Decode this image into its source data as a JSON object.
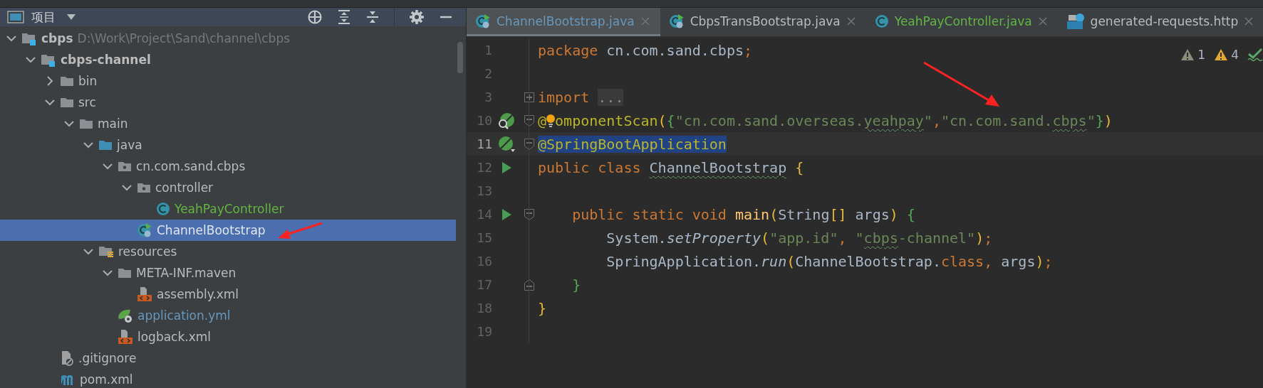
{
  "project_panel": {
    "title": "项目",
    "tree": [
      {
        "name": "cbps",
        "path": "D:\\Work\\Project\\Sand\\channel\\cbps",
        "kind": "module",
        "bold": true,
        "expanded": true,
        "selected": false,
        "children": [
          {
            "name": "cbps-channel",
            "kind": "module",
            "bold": true,
            "expanded": true,
            "selected": false,
            "children": [
              {
                "name": "bin",
                "kind": "folder",
                "expanded": false,
                "selected": false
              },
              {
                "name": "src",
                "kind": "folder",
                "expanded": true,
                "selected": false,
                "children": [
                  {
                    "name": "main",
                    "kind": "folder",
                    "expanded": true,
                    "selected": false,
                    "children": [
                      {
                        "name": "java",
                        "kind": "source-folder",
                        "expanded": true,
                        "selected": false,
                        "children": [
                          {
                            "name": "cn.com.sand.cbps",
                            "kind": "package",
                            "expanded": true,
                            "selected": false,
                            "children": [
                              {
                                "name": "controller",
                                "kind": "package",
                                "expanded": true,
                                "selected": false,
                                "children": [
                                  {
                                    "name": "YeahPayController",
                                    "kind": "class",
                                    "color": "#62b543",
                                    "selected": false
                                  }
                                ]
                              },
                              {
                                "name": "ChannelBootstrap",
                                "kind": "spring-class",
                                "selected": true
                              }
                            ]
                          }
                        ]
                      },
                      {
                        "name": "resources",
                        "kind": "resources-folder",
                        "expanded": true,
                        "selected": false,
                        "children": [
                          {
                            "name": "META-INF.maven",
                            "kind": "folder",
                            "expanded": true,
                            "selected": false,
                            "children": [
                              {
                                "name": "assembly.xml",
                                "kind": "xml",
                                "selected": false
                              }
                            ]
                          },
                          {
                            "name": "application.yml",
                            "kind": "yml",
                            "color": "#6897bb",
                            "selected": false
                          },
                          {
                            "name": "logback.xml",
                            "kind": "xml",
                            "selected": false
                          }
                        ]
                      }
                    ]
                  }
                ]
              },
              {
                "name": ".gitignore",
                "kind": "ignore-file",
                "selected": false
              },
              {
                "name": "pom.xml",
                "kind": "maven",
                "selected": false
              }
            ]
          }
        ]
      }
    ]
  },
  "editor": {
    "tabs": [
      {
        "label": "ChannelBootstrap.java",
        "kind": "spring-class",
        "color": "#6897bb",
        "selected": true
      },
      {
        "label": "CbpsTransBootstrap.java",
        "kind": "spring-class",
        "selected": false
      },
      {
        "label": "YeahPayController.java",
        "kind": "class",
        "color": "#62b543",
        "selected": false
      },
      {
        "label": "generated-requests.http",
        "kind": "api",
        "selected": false
      }
    ],
    "inspections": [
      {
        "kind": "weak-warning",
        "count": "1"
      },
      {
        "kind": "warning",
        "count": "4"
      },
      {
        "kind": "typo"
      }
    ],
    "lines": [
      {
        "number": "1",
        "tokens": [
          {
            "text": "package ",
            "kind": "keyword"
          },
          {
            "text": "cn.com.sand.cbps",
            "kind": "plain"
          },
          {
            "text": ";",
            "kind": "keyword"
          }
        ]
      },
      {
        "number": "2"
      },
      {
        "number": "3",
        "fold": {
          "kind": "expand"
        },
        "tokens": [
          {
            "text": "import ",
            "kind": "keyword"
          },
          {
            "text": "...",
            "kind": "folded"
          }
        ]
      },
      {
        "number": "10",
        "gutter": {
          "kind": "bean-search"
        },
        "fold": {
          "kind": "start"
        },
        "tokens": [
          {
            "text": "@",
            "kind": "annotation"
          },
          {
            "kind": "bulb"
          },
          {
            "text": "omponentScan",
            "kind": "annotation"
          },
          {
            "text": "(",
            "kind": "bracket-1"
          },
          {
            "text": "{",
            "kind": "bracket-2"
          },
          {
            "text": "\"cn.com.sand.overseas.",
            "kind": "string"
          },
          {
            "text": "yeahpay",
            "kind": "string",
            "typo": true
          },
          {
            "text": "\"",
            "kind": "string"
          },
          {
            "text": ",",
            "kind": "keyword"
          },
          {
            "text": "\"cn.com.sand.",
            "kind": "string"
          },
          {
            "text": "cbps",
            "kind": "string",
            "typo": true
          },
          {
            "text": "\"",
            "kind": "string"
          },
          {
            "text": "}",
            "kind": "bracket-2"
          },
          {
            "text": ")",
            "kind": "bracket-1"
          }
        ]
      },
      {
        "number": "11",
        "current": true,
        "gutter": {
          "kind": "bean"
        },
        "fold": {
          "kind": "start"
        },
        "tokens": [
          {
            "text": "@SpringBootApplication",
            "kind": "annotation",
            "selected": true
          }
        ]
      },
      {
        "number": "12",
        "gutter": {
          "kind": "run"
        },
        "tokens": [
          {
            "text": "public class ",
            "kind": "keyword"
          },
          {
            "text": "ChannelBootstrap",
            "kind": "plain",
            "typo": true
          },
          {
            "text": " {",
            "kind": "bracket-1"
          }
        ]
      },
      {
        "number": "13"
      },
      {
        "number": "14",
        "gutter": {
          "kind": "run"
        },
        "fold": {
          "kind": "start"
        },
        "tokens": [
          {
            "text": "    public static void ",
            "kind": "keyword"
          },
          {
            "text": "main",
            "kind": "method"
          },
          {
            "text": "(",
            "kind": "bracket-1"
          },
          {
            "text": "String",
            "kind": "plain"
          },
          {
            "text": "[]",
            "kind": "bracket-1"
          },
          {
            "text": " args",
            "kind": "plain"
          },
          {
            "text": ")",
            "kind": "bracket-1"
          },
          {
            "text": " {",
            "kind": "bracket-2"
          }
        ]
      },
      {
        "number": "15",
        "tokens": [
          {
            "text": "        System.",
            "kind": "plain"
          },
          {
            "text": "setProperty",
            "kind": "static-call"
          },
          {
            "text": "(",
            "kind": "bracket-1"
          },
          {
            "text": "\"app.id\"",
            "kind": "string"
          },
          {
            "text": ", ",
            "kind": "keyword"
          },
          {
            "text": "\"",
            "kind": "string"
          },
          {
            "text": "cbps",
            "kind": "string",
            "typo": true
          },
          {
            "text": "-channel\"",
            "kind": "string"
          },
          {
            "text": ")",
            "kind": "bracket-1"
          },
          {
            "text": ";",
            "kind": "keyword"
          }
        ]
      },
      {
        "number": "16",
        "tokens": [
          {
            "text": "        SpringApplication.",
            "kind": "plain"
          },
          {
            "text": "run",
            "kind": "static-call"
          },
          {
            "text": "(",
            "kind": "bracket-1"
          },
          {
            "text": "ChannelBootstrap.",
            "kind": "plain"
          },
          {
            "text": "class",
            "kind": "keyword"
          },
          {
            "text": ", ",
            "kind": "keyword"
          },
          {
            "text": "args",
            "kind": "plain"
          },
          {
            "text": ")",
            "kind": "bracket-1"
          },
          {
            "text": ";",
            "kind": "keyword"
          }
        ]
      },
      {
        "number": "17",
        "fold": {
          "kind": "end"
        },
        "tokens": [
          {
            "text": "    }",
            "kind": "bracket-2"
          }
        ]
      },
      {
        "number": "18",
        "tokens": [
          {
            "text": "}",
            "kind": "bracket-1"
          }
        ]
      },
      {
        "number": "19"
      }
    ]
  }
}
